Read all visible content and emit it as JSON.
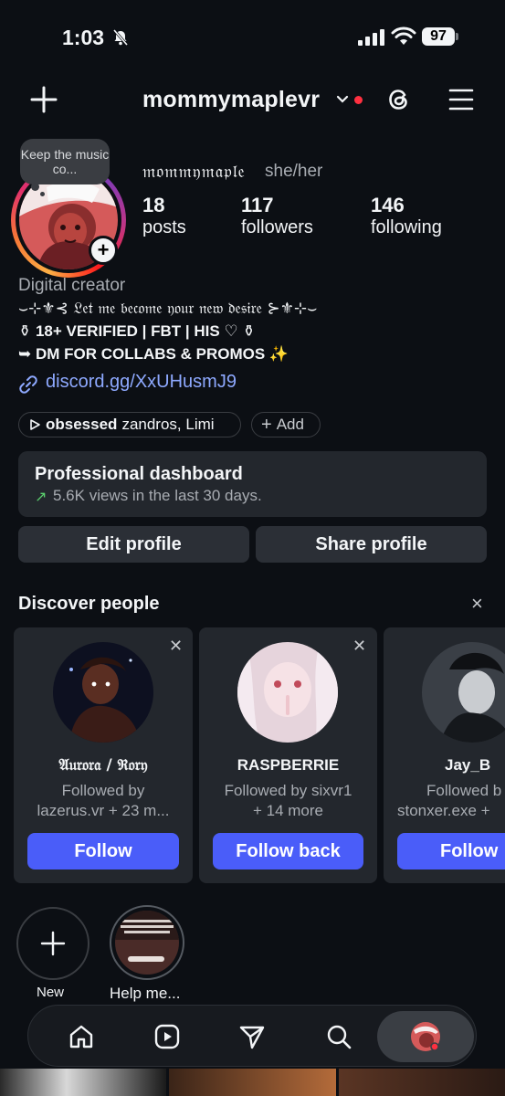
{
  "status_bar": {
    "time": "1:03",
    "battery": "97"
  },
  "header": {
    "username": "mommymaplevr"
  },
  "profile": {
    "note": "Keep the music co...",
    "display_name": "𝔪𝔬𝔪𝔪𝔶𝔪𝔞𝔭𝔩𝔢",
    "pronouns": "she/her",
    "stats": [
      {
        "value": "18",
        "label": "posts"
      },
      {
        "value": "117",
        "label": "followers"
      },
      {
        "value": "146",
        "label": "following"
      }
    ],
    "category": "Digital creator",
    "bio_lines": [
      "⌣⊹⚜︎⊰ 𝔏𝔢𝔱 𝔪𝔢 𝔟𝔢𝔠𝔬𝔪𝔢 𝔶𝔬𝔲𝔯 𝔫𝔢𝔴 𝔡𝔢𝔰𝔦𝔯𝔢 ⊱⚜︎⊹⌣",
      "⚱ 18+ VERIFIED | FBT | HIS ♡ ⚱",
      "➥ DM FOR COLLABS & PROMOS ✨"
    ],
    "link": "discord.gg/XxUHusmJ9",
    "music_chip": {
      "song": "obsessed",
      "artists": "zandros, Limi"
    },
    "add_chip": "Add"
  },
  "dashboard": {
    "title": "Professional dashboard",
    "subtitle": "5.6K views in the last 30 days."
  },
  "buttons": {
    "edit": "Edit profile",
    "share": "Share profile"
  },
  "discover": {
    "title": "Discover people",
    "cards": [
      {
        "name": "𝔄𝔲𝔯𝔬𝔯𝔞 / ℜ𝔬𝔯𝔶",
        "sub1": "Followed by",
        "sub2": "lazerus.vr + 23 m...",
        "button": "Follow"
      },
      {
        "name": "RASPBERRIE",
        "sub1": "Followed by sixvr1",
        "sub2": "+ 14 more",
        "button": "Follow back"
      },
      {
        "name": "Jay_B",
        "sub1": "Followed b",
        "sub2": "stonxer.exe +",
        "button": "Follow"
      }
    ]
  },
  "highlights": [
    {
      "label": "New"
    },
    {
      "label": "Help me..."
    }
  ],
  "colors": {
    "accent": "#4a5df9",
    "link": "#8ea9ff",
    "notification": "#ff3040"
  }
}
